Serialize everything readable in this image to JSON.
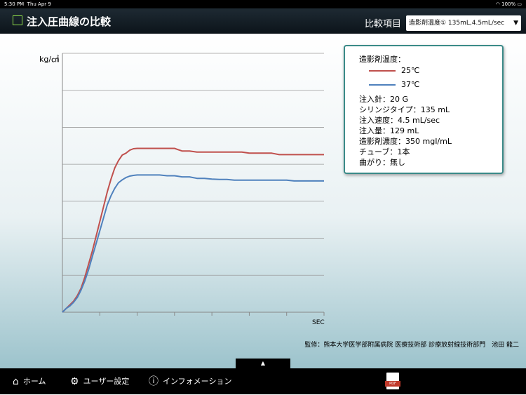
{
  "status_bar": {
    "time": "5:30 PM",
    "date": "Thu Apr 9",
    "battery": "100%"
  },
  "header": {
    "title": "注入圧曲線の比較",
    "compare_label": "比較項目",
    "compare_value": "造影剤温度① 135mL,4.5mL/sec"
  },
  "chart_data": {
    "type": "line",
    "ylabel": "kg/㎠",
    "xlabel": "SEC",
    "ylim": [
      0,
      7
    ],
    "xlim": [
      0,
      70
    ],
    "grid": true,
    "legend": "top-right",
    "series": [
      {
        "name": "25℃",
        "color": "#c0504d",
        "x": [
          0,
          1,
          2,
          3,
          4,
          5,
          6,
          7,
          8,
          9,
          10,
          11,
          12,
          13,
          14,
          15,
          16,
          17,
          18,
          19,
          20,
          21,
          22,
          23,
          24,
          26,
          28,
          30,
          32,
          34,
          36,
          38,
          40,
          42,
          44,
          46,
          48,
          50,
          52,
          54,
          56,
          58,
          60,
          62,
          64,
          66,
          68,
          70
        ],
        "y": [
          0,
          0.1,
          0.2,
          0.3,
          0.45,
          0.65,
          0.95,
          1.3,
          1.65,
          2.05,
          2.45,
          2.85,
          3.25,
          3.6,
          3.9,
          4.1,
          4.25,
          4.3,
          4.38,
          4.42,
          4.43,
          4.43,
          4.43,
          4.43,
          4.43,
          4.43,
          4.43,
          4.43,
          4.36,
          4.36,
          4.33,
          4.33,
          4.33,
          4.33,
          4.33,
          4.33,
          4.33,
          4.3,
          4.3,
          4.3,
          4.3,
          4.26,
          4.26,
          4.26,
          4.26,
          4.26,
          4.26,
          4.26
        ]
      },
      {
        "name": "37℃",
        "color": "#4f81bd",
        "x": [
          0,
          1,
          2,
          3,
          4,
          5,
          6,
          7,
          8,
          9,
          10,
          11,
          12,
          13,
          14,
          15,
          16,
          17,
          18,
          19,
          20,
          21,
          22,
          23,
          24,
          26,
          28,
          30,
          32,
          34,
          36,
          38,
          40,
          42,
          44,
          46,
          48,
          50,
          52,
          54,
          56,
          58,
          60,
          62,
          64,
          66,
          68,
          70
        ],
        "y": [
          0,
          0.1,
          0.17,
          0.27,
          0.4,
          0.6,
          0.85,
          1.15,
          1.5,
          1.85,
          2.2,
          2.55,
          2.9,
          3.15,
          3.35,
          3.5,
          3.58,
          3.64,
          3.68,
          3.7,
          3.71,
          3.71,
          3.71,
          3.71,
          3.71,
          3.71,
          3.69,
          3.69,
          3.66,
          3.66,
          3.62,
          3.62,
          3.6,
          3.59,
          3.59,
          3.57,
          3.57,
          3.57,
          3.57,
          3.57,
          3.57,
          3.57,
          3.57,
          3.55,
          3.55,
          3.55,
          3.55,
          3.55
        ]
      }
    ]
  },
  "legend_box": {
    "heading": "造影剤温度：",
    "specs": [
      "注入針：20 G",
      "シリンジタイプ：135 mL",
      "注入速度：4.5 mL/sec",
      "注入量：129 mL",
      "造影剤濃度：350 mgI/mL",
      "チューブ：1本",
      "曲がり：無し"
    ]
  },
  "credit": "監修：熊本大学医学部附属病院 医療技術部 診療放射線技術部門　池田 龍二",
  "tab_handle_icon": "▲",
  "footer": {
    "home_label": "ホーム",
    "home_icon": "home-icon",
    "user_settings_label": "ユーザー設定",
    "settings_icon": "gear-icon",
    "info_label": "インフォメーション",
    "info_icon": "info-icon",
    "pdf_icon": "pdf-icon",
    "pdf_tag": "PDF"
  }
}
